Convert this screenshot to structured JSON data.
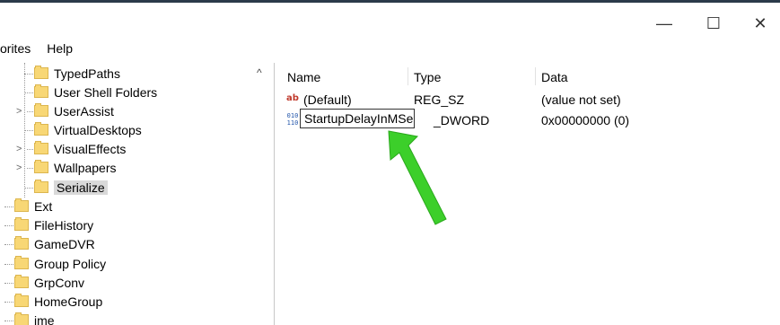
{
  "window": {
    "minimize": "—",
    "maximize": "☐",
    "close": "✕"
  },
  "menu": [
    "orites",
    "Help"
  ],
  "tree": {
    "scroll_up": "^",
    "items": [
      {
        "label": "TypedPaths"
      },
      {
        "label": "User Shell Folders"
      },
      {
        "label": "UserAssist",
        "expander": ">"
      },
      {
        "label": "VirtualDesktops"
      },
      {
        "label": "VisualEffects",
        "expander": ">"
      },
      {
        "label": "Wallpapers",
        "expander": ">"
      },
      {
        "label": "Serialize",
        "selected": true
      },
      {
        "label": "Ext"
      },
      {
        "label": "FileHistory"
      },
      {
        "label": "GameDVR"
      },
      {
        "label": "Group Policy"
      },
      {
        "label": "GrpConv"
      },
      {
        "label": "HomeGroup"
      },
      {
        "label": "ime"
      }
    ]
  },
  "values_pane": {
    "columns": {
      "name": "Name",
      "type": "Type",
      "data": "Data"
    },
    "rows": [
      {
        "icon": "ab",
        "name": "(Default)",
        "type": "REG_SZ",
        "data": "(value not set)"
      },
      {
        "icon": "bin",
        "name": "",
        "type": "_DWORD",
        "data": "0x00000000 (0)"
      }
    ],
    "rename_value": "StartupDelayInMSec"
  },
  "icons": {
    "folder": "folder-icon",
    "string_value": "reg-sz-icon",
    "binary_value": "reg-dword-icon",
    "arrow": "arrow-annotation-icon"
  },
  "colors": {
    "folder": "#f8d775",
    "arrow": "#3ccf2a",
    "selection": "#d9d9d9"
  }
}
